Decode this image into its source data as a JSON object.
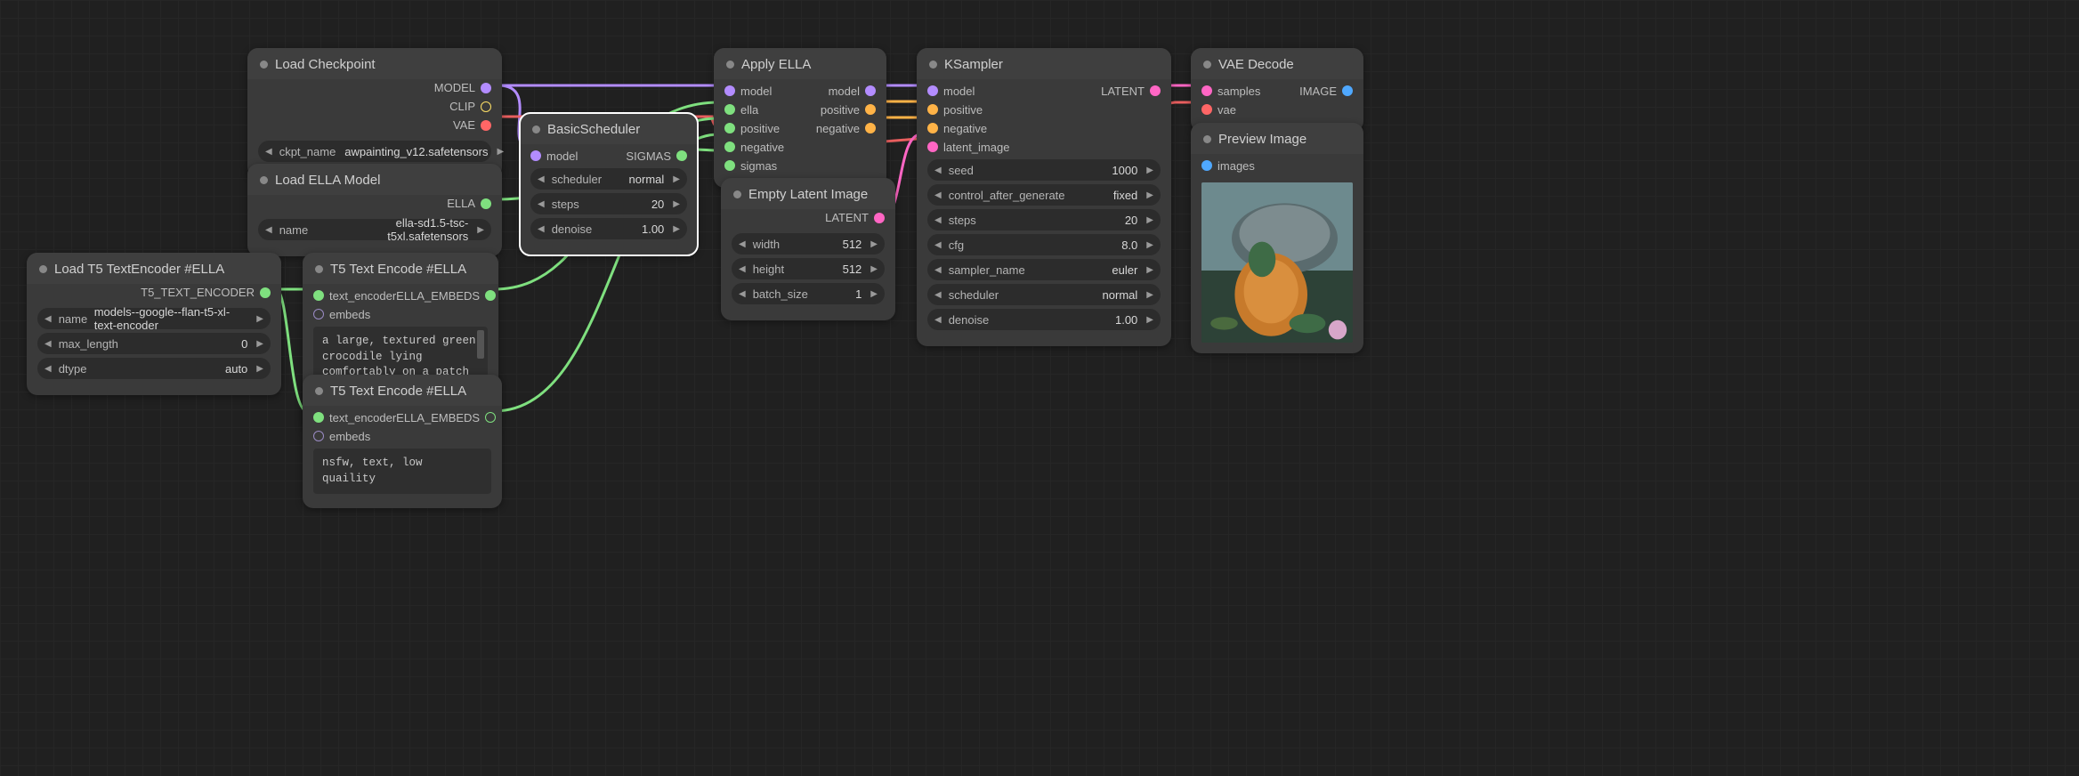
{
  "nodes": {
    "load_checkpoint": {
      "title": "Load Checkpoint",
      "outputs": {
        "model": "MODEL",
        "clip": "CLIP",
        "vae": "VAE"
      },
      "ckpt_name_label": "ckpt_name",
      "ckpt_name_value": "awpainting_v12.safetensors"
    },
    "load_ella": {
      "title": "Load ELLA Model",
      "outputs": {
        "ella": "ELLA"
      },
      "name_label": "name",
      "name_value": "ella-sd1.5-tsc-t5xl.safetensors"
    },
    "load_t5": {
      "title": "Load T5 TextEncoder #ELLA",
      "outputs": {
        "enc": "T5_TEXT_ENCODER"
      },
      "name_label": "name",
      "name_value": "models--google--flan-t5-xl-text-encoder",
      "max_length_label": "max_length",
      "max_length_value": "0",
      "dtype_label": "dtype",
      "dtype_value": "auto"
    },
    "t5_encode_pos": {
      "title": "T5 Text Encode #ELLA",
      "inputs": {
        "enc": "text_encoder",
        "emb": "embeds"
      },
      "outputs": {
        "emb": "ELLA_EMBEDS"
      },
      "prompt": "a large, textured green crocodile lying comfortably on a patch of grass with a cute, knitted orange"
    },
    "t5_encode_neg": {
      "title": "T5 Text Encode #ELLA",
      "inputs": {
        "enc": "text_encoder",
        "emb": "embeds"
      },
      "outputs": {
        "emb": "ELLA_EMBEDS"
      },
      "prompt": "nsfw, text, low quaility"
    },
    "basic_sched": {
      "title": "BasicScheduler",
      "inputs": {
        "model": "model"
      },
      "outputs": {
        "sigmas": "SIGMAS"
      },
      "scheduler_label": "scheduler",
      "scheduler_value": "normal",
      "steps_label": "steps",
      "steps_value": "20",
      "denoise_label": "denoise",
      "denoise_value": "1.00"
    },
    "apply_ella": {
      "title": "Apply ELLA",
      "inputs": {
        "model": "model",
        "ella": "ella",
        "positive": "positive",
        "negative": "negative",
        "sigmas": "sigmas"
      },
      "outputs": {
        "model": "model",
        "positive": "positive",
        "negative": "negative"
      }
    },
    "empty_latent": {
      "title": "Empty Latent Image",
      "outputs": {
        "latent": "LATENT"
      },
      "width_label": "width",
      "width_value": "512",
      "height_label": "height",
      "height_value": "512",
      "batch_label": "batch_size",
      "batch_value": "1"
    },
    "ksampler": {
      "title": "KSampler",
      "inputs": {
        "model": "model",
        "positive": "positive",
        "negative": "negative",
        "latent": "latent_image"
      },
      "outputs": {
        "latent": "LATENT"
      },
      "seed_label": "seed",
      "seed_value": "1000",
      "ctrl_label": "control_after_generate",
      "ctrl_value": "fixed",
      "steps_label": "steps",
      "steps_value": "20",
      "cfg_label": "cfg",
      "cfg_value": "8.0",
      "sampler_label": "sampler_name",
      "sampler_value": "euler",
      "scheduler_label": "scheduler",
      "scheduler_value": "normal",
      "denoise_label": "denoise",
      "denoise_value": "1.00"
    },
    "vae_decode": {
      "title": "VAE Decode",
      "inputs": {
        "samples": "samples",
        "vae": "vae"
      },
      "outputs": {
        "image": "IMAGE"
      }
    },
    "preview": {
      "title": "Preview Image",
      "inputs": {
        "images": "images"
      }
    }
  },
  "colors": {
    "model": "#b38cff",
    "clip": "#ffe066",
    "vae": "#ff6666",
    "ella": "#7fe07f",
    "cond_pos": "#ffb347",
    "cond_neg": "#ffb347",
    "sigmas": "#7fe07f",
    "latent": "#ff66c4",
    "embeds": "#7fe07f",
    "image": "#4fa8ff",
    "t5enc": "#7fe07f",
    "embeds_in": "#9a8bc4"
  }
}
